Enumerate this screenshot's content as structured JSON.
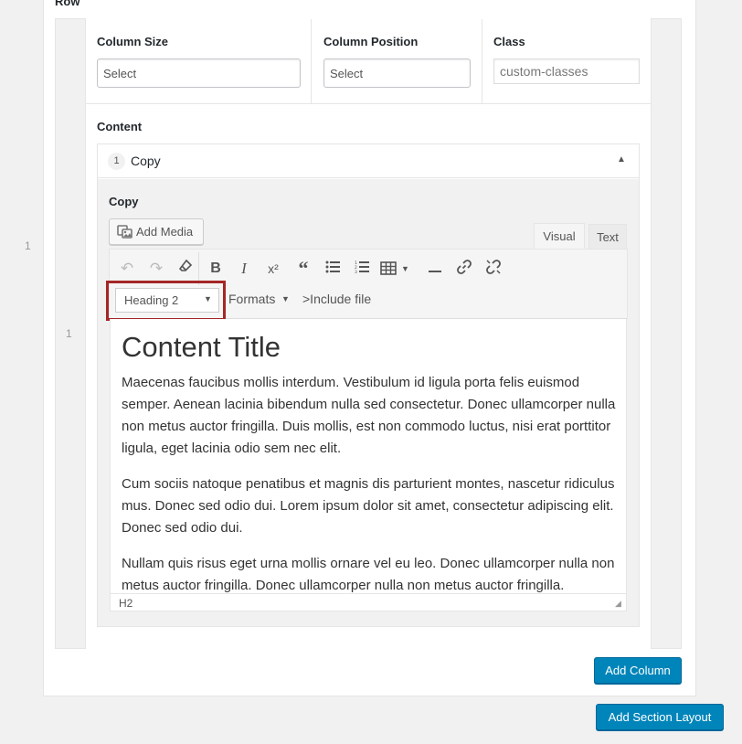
{
  "row": {
    "label": "Row",
    "row_number": "1",
    "column_number": "1"
  },
  "column_settings": {
    "size_label": "Column Size",
    "size_placeholder": "Select",
    "position_label": "Column Position",
    "position_placeholder": "Select",
    "class_label": "Class",
    "class_value": "custom-classes"
  },
  "content": {
    "label": "Content",
    "item_number": "1",
    "item_title": "Copy",
    "collapse_icon": "triangle-up-icon",
    "field_label": "Copy",
    "add_media_label": "Add Media",
    "tabs": {
      "visual": "Visual",
      "text": "Text"
    },
    "toolbar": {
      "icons": [
        "undo-icon",
        "redo-icon",
        "clear-formatting-icon",
        "bold-icon",
        "italic-icon",
        "superscript-icon",
        "blockquote-icon",
        "bullet-list-icon",
        "numbered-list-icon",
        "table-icon",
        "horizontal-rule-icon",
        "link-icon",
        "unlink-icon"
      ],
      "block_format": "Heading 2",
      "formats_label": "Formats",
      "include_file_label": ">Include file"
    },
    "editor": {
      "title": "Content Title",
      "paragraphs": [
        "Maecenas faucibus mollis interdum. Vestibulum id ligula porta felis euismod semper. Aenean lacinia bibendum nulla sed consectetur. Donec ullamcorper nulla non metus auctor fringilla. Duis mollis, est non commodo luctus, nisi erat porttitor ligula, eget lacinia odio sem nec elit.",
        "Cum sociis natoque penatibus et magnis dis parturient montes, nascetur ridiculus mus. Donec sed odio dui. Lorem ipsum dolor sit amet, consectetur adipiscing elit. Donec sed odio dui.",
        "Nullam quis risus eget urna mollis ornare vel eu leo. Donec ullamcorper nulla non metus auctor fringilla. Donec ullamcorper nulla non metus auctor fringilla."
      ],
      "status_path": "H2"
    }
  },
  "buttons": {
    "add_column": "Add Column",
    "add_section_layout": "Add Section Layout"
  },
  "colors": {
    "primary": "#0085ba",
    "highlight": "#a52626"
  }
}
